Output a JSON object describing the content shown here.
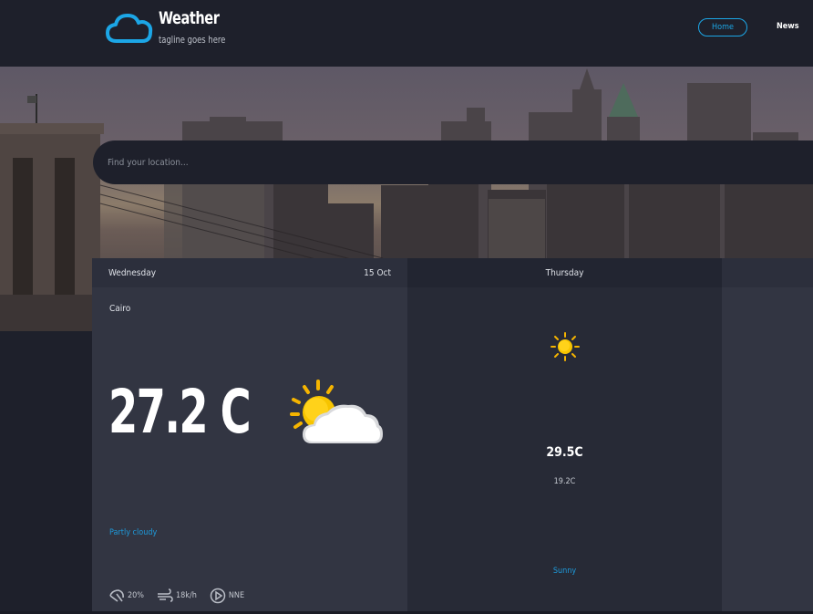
{
  "header": {
    "title": "Weather",
    "tagline": "tagline goes here",
    "logo_icon": "cloud-icon",
    "nav": [
      {
        "label": "Home",
        "active": true
      },
      {
        "label": "News",
        "active": false
      }
    ],
    "accent_color": "#1ca6e6"
  },
  "search": {
    "placeholder": "Find your location..."
  },
  "today": {
    "day": "Wednesday",
    "date": "15 Oct",
    "location": "Cairo",
    "temperature": "27.2 C",
    "icon": "partly-cloudy-icon",
    "description": "Partly cloudy",
    "stats": {
      "precipitation": "20%",
      "wind_speed": "18k/h",
      "wind_direction": "NNE"
    }
  },
  "tomorrow": {
    "day": "Thursday",
    "icon": "sun-icon",
    "max_temp": "29.5C",
    "min_temp": "19.2C",
    "description": "Sunny"
  }
}
